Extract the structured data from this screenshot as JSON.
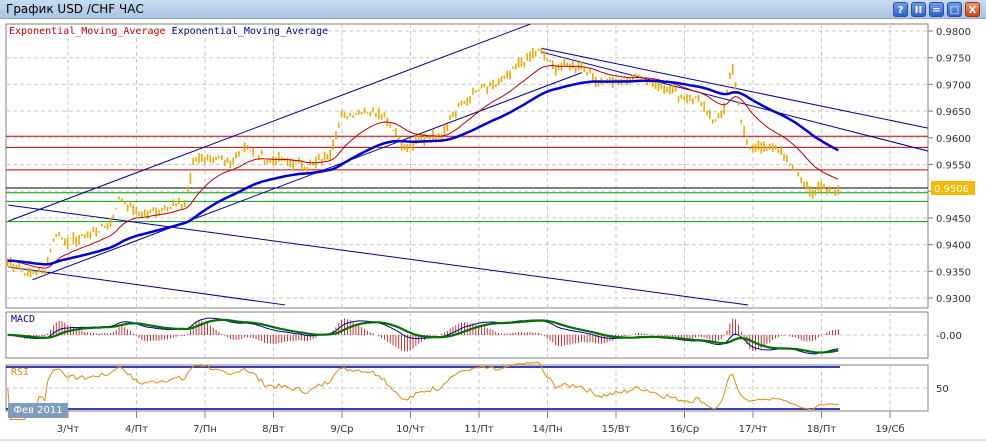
{
  "window": {
    "title": "График USD /CHF  ЧАС",
    "buttons": [
      "?",
      "II",
      "=",
      "□",
      "X"
    ]
  },
  "legend": {
    "ema_fast": "Exponential_Moving_Average",
    "ema_slow": "Exponential_Moving_Average"
  },
  "colors": {
    "price": "#f0a800",
    "ema_fast": "#c00000",
    "ema_slow": "#0000d0",
    "macd": "#000090",
    "signal": "#007000",
    "rsi": "#e08a10",
    "resistance": "#c00000",
    "support": "#00a000",
    "trend": "#000090"
  },
  "period_badge": "Фев 2011",
  "chart_data": {
    "type": "line",
    "title": "График USD /CHF  ЧАС",
    "categories": [
      "3/Чт",
      "4/Пт",
      "7/Пн",
      "8/Вт",
      "9/Ср",
      "10/Чт",
      "11/Пт",
      "14/Пн",
      "15/Вт",
      "16/Ср",
      "17/Чт",
      "18/Пт",
      "19/Сб"
    ],
    "ylim": [
      0.9285,
      0.9815
    ],
    "yticks": [
      "0.9800",
      "0.9750",
      "0.9700",
      "0.9650",
      "0.9600",
      "0.9550",
      "0.9500",
      "0.9450",
      "0.9400",
      "0.9350",
      "0.9300"
    ],
    "last_price": "0.9506",
    "price_path": [
      [
        -0.88,
        0.937
      ],
      [
        -0.55,
        0.9345
      ],
      [
        -0.34,
        0.935
      ],
      [
        -0.19,
        0.942
      ],
      [
        0.03,
        0.9405
      ],
      [
        0.32,
        0.942
      ],
      [
        0.61,
        0.944
      ],
      [
        0.76,
        0.949
      ],
      [
        1.05,
        0.9455
      ],
      [
        1.42,
        0.947
      ],
      [
        1.71,
        0.948
      ],
      [
        1.85,
        0.956
      ],
      [
        2.07,
        0.9565
      ],
      [
        2.36,
        0.955
      ],
      [
        2.58,
        0.9585
      ],
      [
        2.88,
        0.956
      ],
      [
        3.24,
        0.9555
      ],
      [
        3.53,
        0.9545
      ],
      [
        3.82,
        0.957
      ],
      [
        3.97,
        0.9635
      ],
      [
        4.26,
        0.965
      ],
      [
        4.55,
        0.965
      ],
      [
        4.77,
        0.9615
      ],
      [
        4.92,
        0.958
      ],
      [
        5.21,
        0.96
      ],
      [
        5.43,
        0.9605
      ],
      [
        5.72,
        0.966
      ],
      [
        6.01,
        0.969
      ],
      [
        6.31,
        0.97
      ],
      [
        6.6,
        0.974
      ],
      [
        6.86,
        0.9765
      ],
      [
        7.11,
        0.973
      ],
      [
        7.47,
        0.9735
      ],
      [
        7.77,
        0.9705
      ],
      [
        8.06,
        0.9705
      ],
      [
        8.35,
        0.9715
      ],
      [
        8.64,
        0.97
      ],
      [
        8.93,
        0.968
      ],
      [
        9.23,
        0.967
      ],
      [
        9.45,
        0.963
      ],
      [
        9.59,
        0.9655
      ],
      [
        9.69,
        0.974
      ],
      [
        9.81,
        0.964
      ],
      [
        9.96,
        0.958
      ],
      [
        10.18,
        0.9585
      ],
      [
        10.47,
        0.957
      ],
      [
        10.69,
        0.952
      ],
      [
        10.83,
        0.95
      ],
      [
        11.12,
        0.9505
      ],
      [
        11.27,
        0.9506
      ]
    ],
    "horizontal_levels": {
      "resistance": [
        0.9603,
        0.9582,
        0.954
      ],
      "current": 0.9506,
      "support": [
        0.9497,
        0.9481,
        0.9443
      ]
    },
    "trend_lines": [
      [
        [
          -0.87,
          0.9474
        ],
        [
          9.93,
          0.9287
        ]
      ],
      [
        [
          -0.87,
          0.9358
        ],
        [
          3.17,
          0.9287
        ]
      ],
      [
        [
          -0.87,
          0.9444
        ],
        [
          6.75,
          0.9813
        ]
      ],
      [
        [
          -0.52,
          0.9334
        ],
        [
          7.5,
          0.9722
        ]
      ],
      [
        [
          6.9,
          0.9768
        ],
        [
          12.56,
          0.9618
        ]
      ],
      [
        [
          6.9,
          0.9761
        ],
        [
          12.56,
          0.9575
        ]
      ]
    ],
    "macd": {
      "label": "MACD",
      "tick": "-0.00"
    },
    "rsi": {
      "label": "RSI",
      "tick": "50",
      "levels": [
        70,
        30
      ]
    }
  }
}
